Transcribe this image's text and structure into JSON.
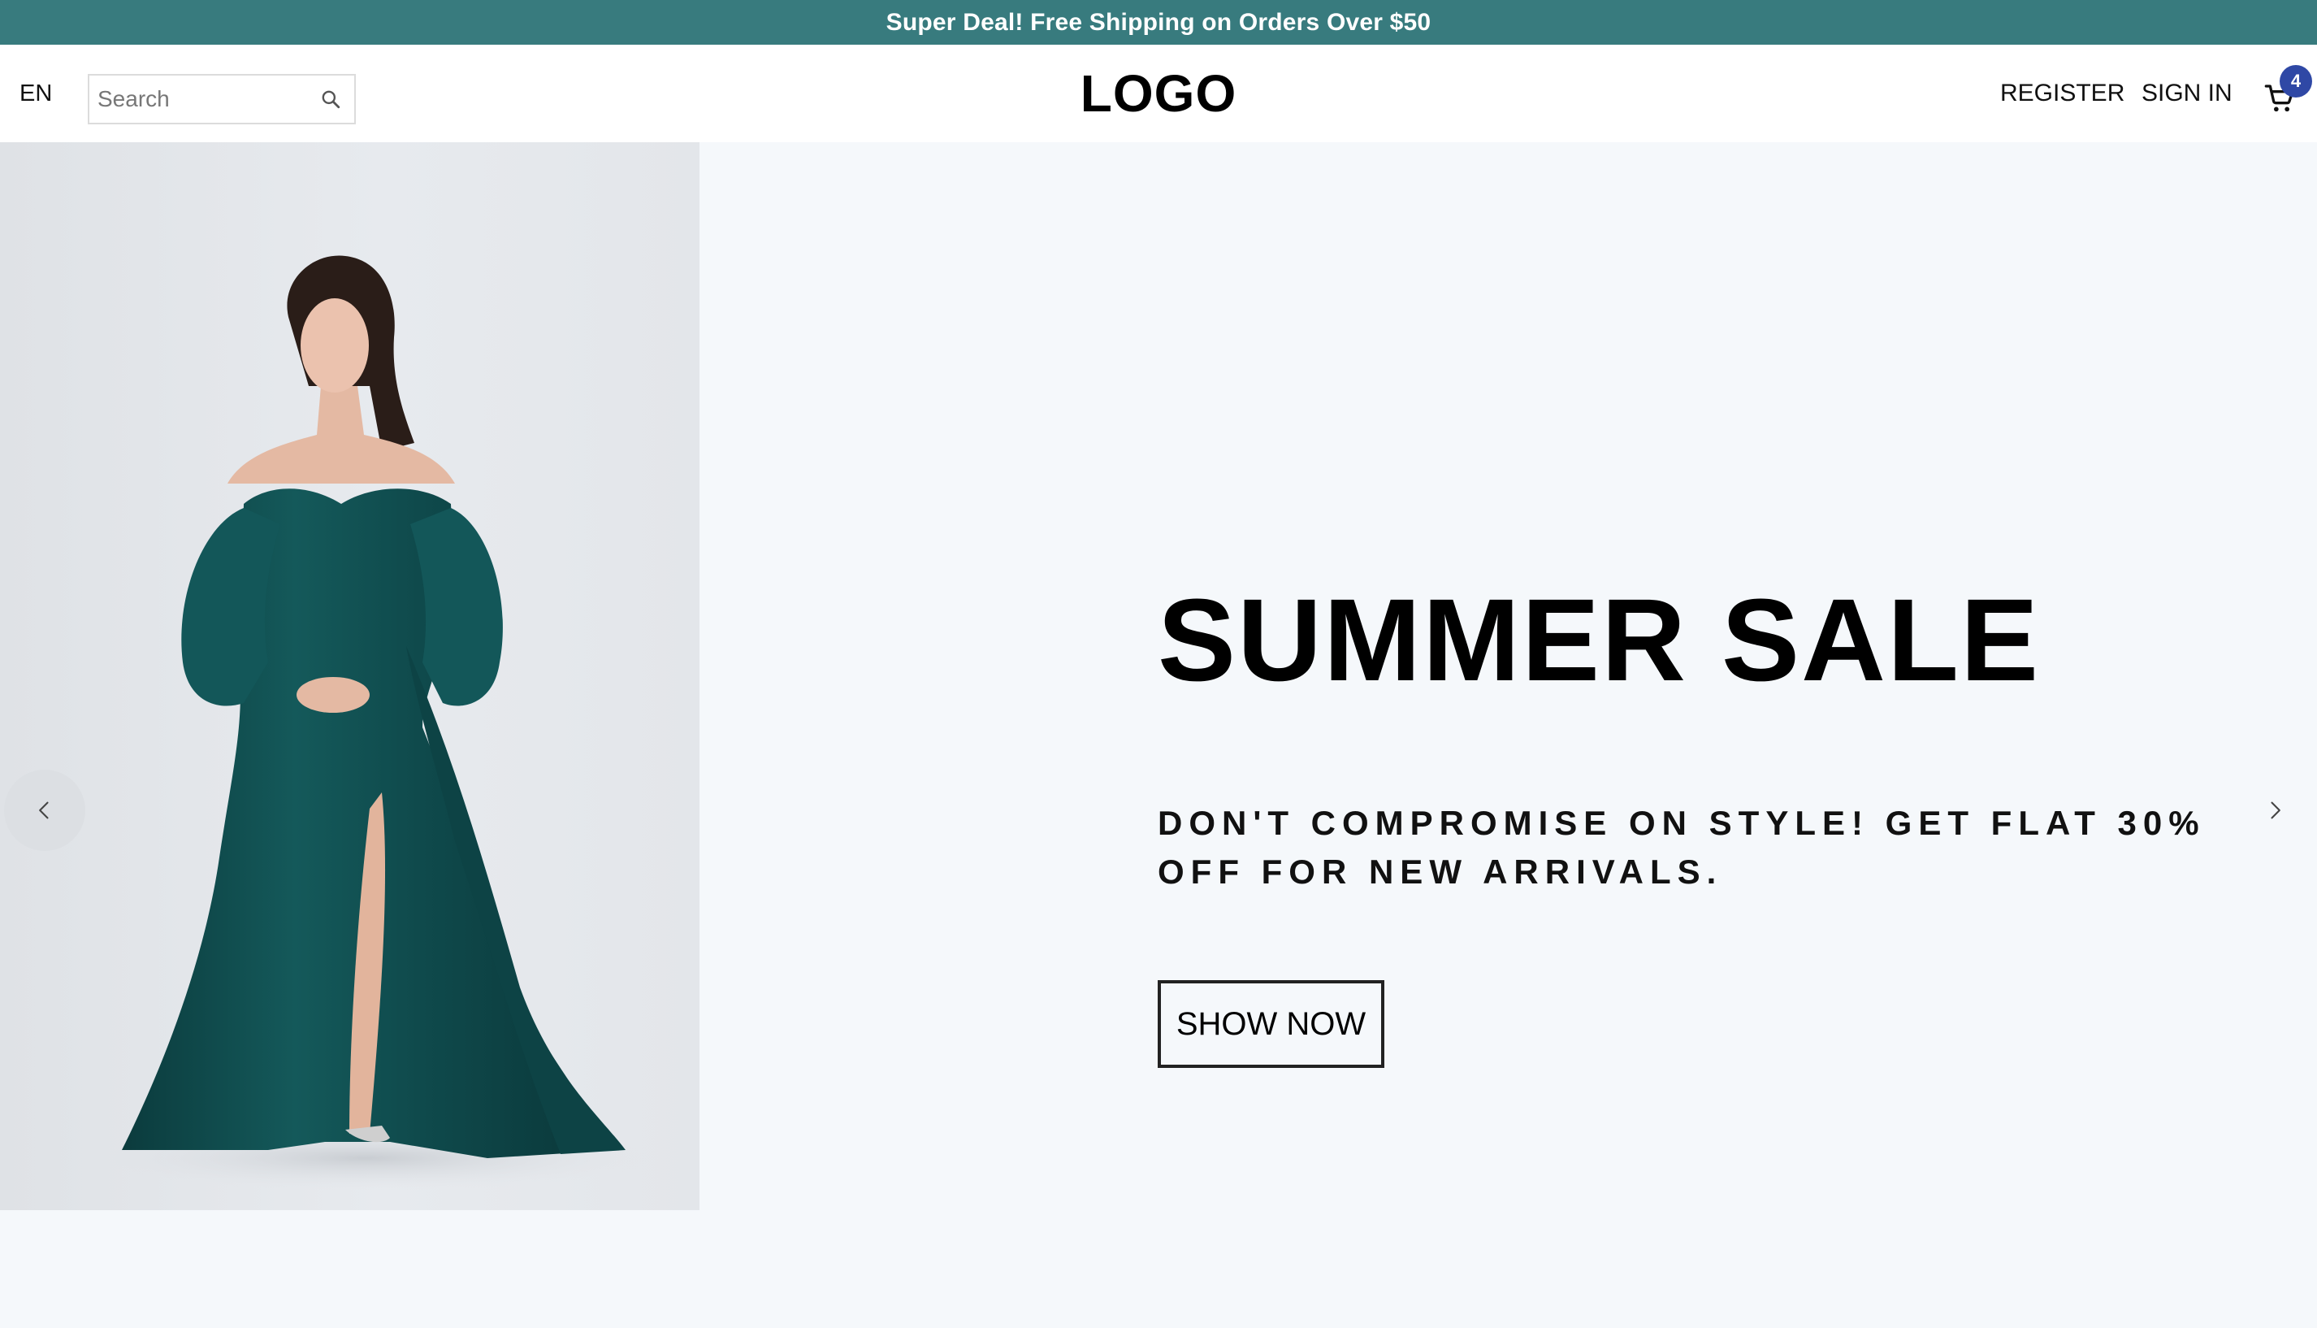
{
  "announcement": {
    "text": "Super Deal! Free Shipping on Orders Over $50",
    "background": "#387b7e"
  },
  "header": {
    "language": "EN",
    "search": {
      "placeholder": "Search",
      "value": "",
      "icon": "search-icon"
    },
    "logo": "LOGO",
    "nav": {
      "register": "REGISTER",
      "sign_in": "SIGN IN"
    },
    "cart": {
      "icon": "cart-icon",
      "count": "4",
      "badge_color": "#2f48a5"
    }
  },
  "hero": {
    "image": {
      "subject": "model-in-green-gown",
      "dress_color": "#0f4c4c"
    },
    "title": "SUMMER SALE",
    "subtitle": "DON'T COMPROMISE ON STYLE! GET FLAT 30% OFF FOR NEW ARRIVALS.",
    "cta_label": "SHOW NOW",
    "prev_icon": "chevron-left-icon",
    "next_icon": "chevron-right-icon"
  }
}
